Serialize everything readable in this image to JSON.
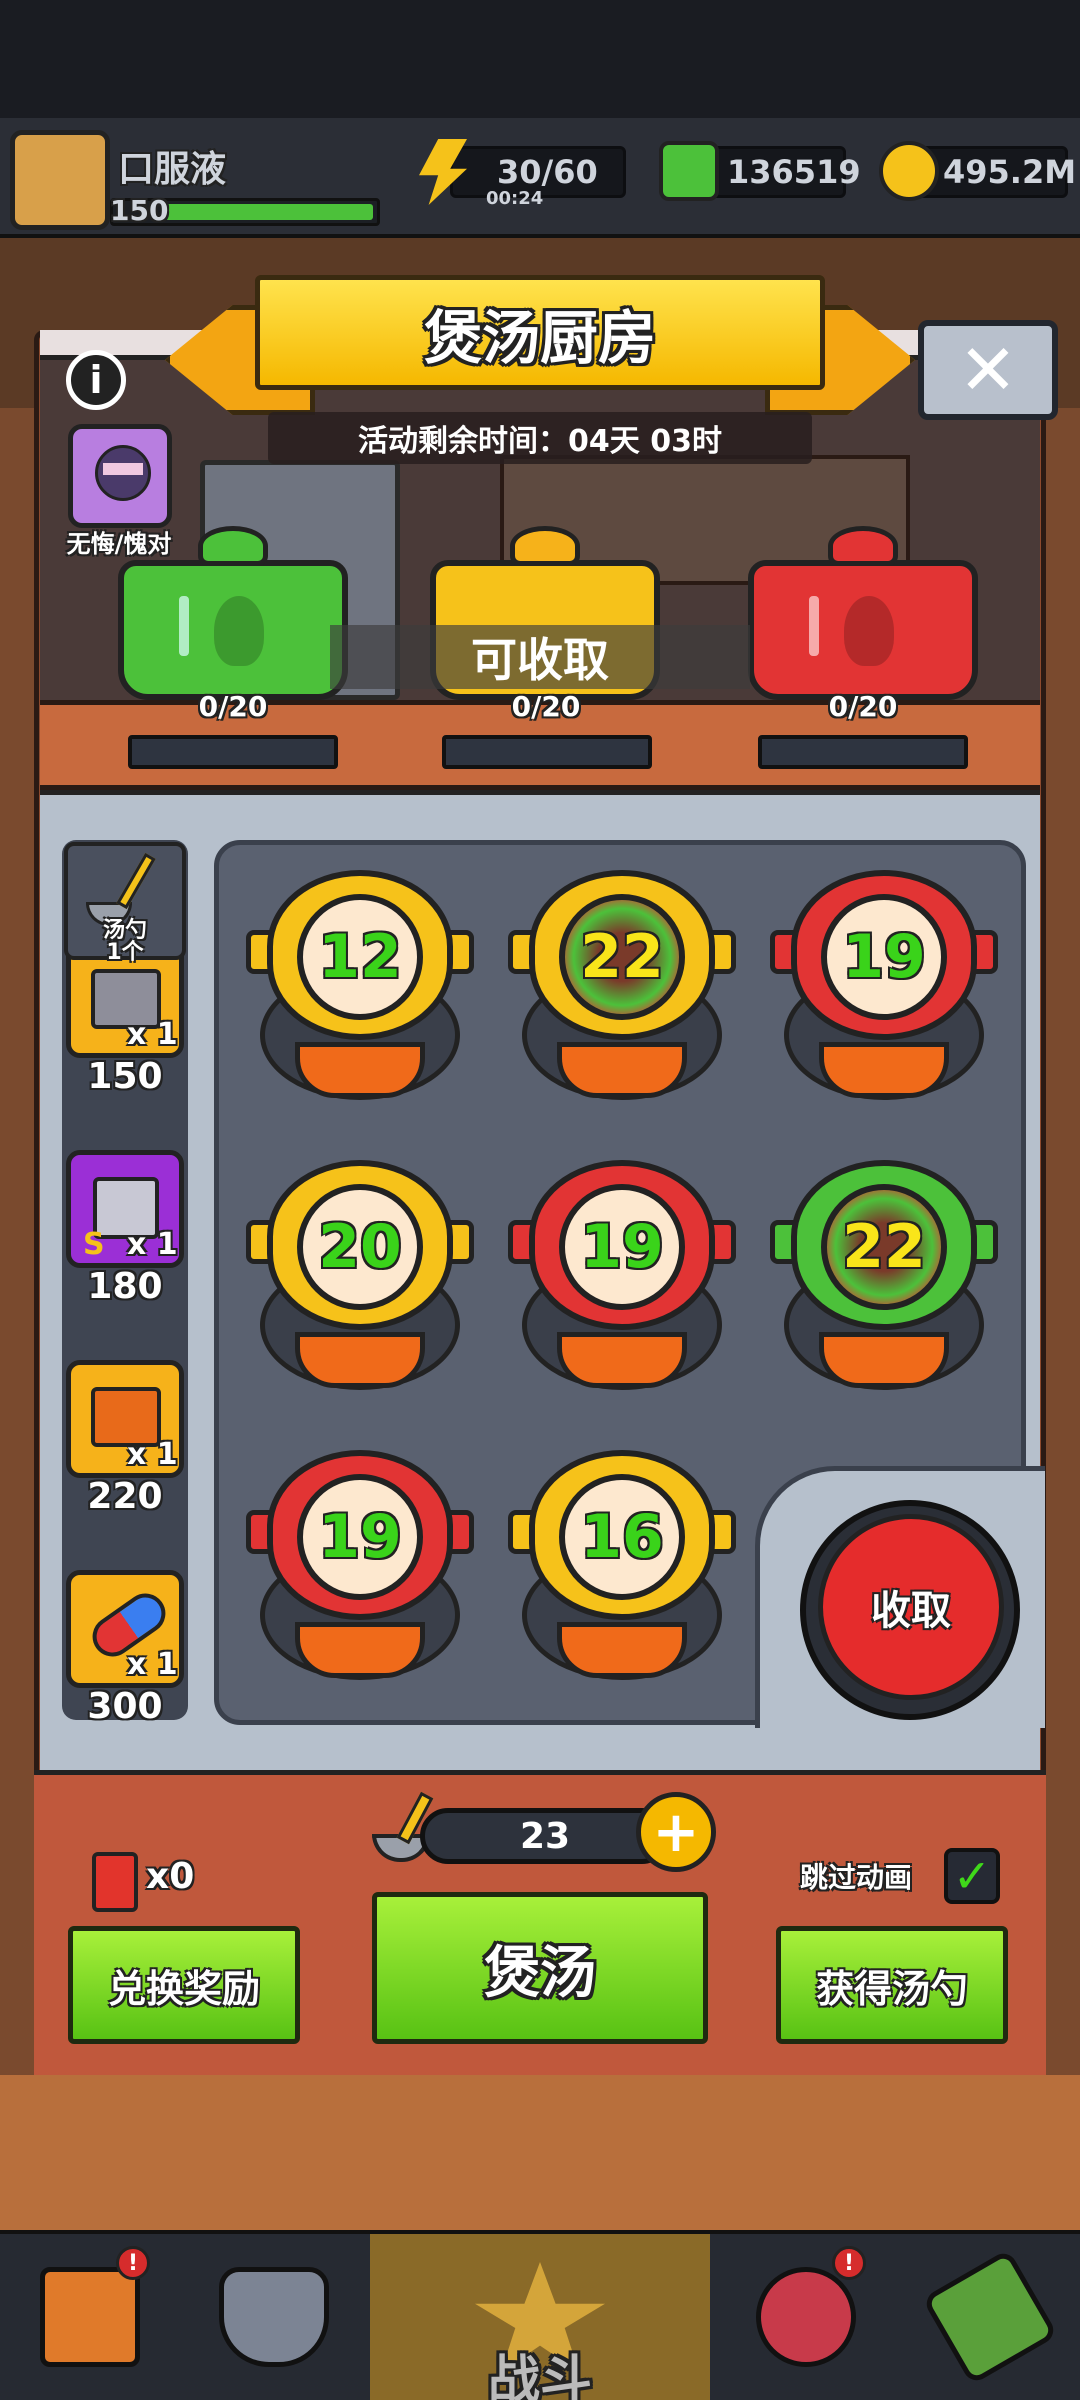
{
  "header": {
    "player_name": "口服液",
    "player_level": "150",
    "energy": "30/60",
    "energy_timer": "00:24",
    "gems": "136519",
    "coins": "495.2M"
  },
  "dialog": {
    "title": "煲汤厨房",
    "time_remaining": "活动剩余时间：04天 03时",
    "avatar_caption": "无悔/愧对",
    "collectable_label": "可收取",
    "big_pots": [
      {
        "color": "#4cc13a",
        "progress": "0/20"
      },
      {
        "color": "#f6c21a",
        "progress": "0/20"
      },
      {
        "color": "#e23434",
        "progress": "0/20"
      }
    ]
  },
  "sidebar": {
    "ladle_slot_label": "汤勺\n1个",
    "rewards": [
      {
        "icon": "orange-chest-icon",
        "qty": "x 1",
        "cost": "150"
      },
      {
        "icon": "purple-chest-icon",
        "qty": "x 1",
        "cost": "180",
        "tag": "S"
      },
      {
        "icon": "skull-chest-icon",
        "qty": "x 1",
        "cost": "220"
      },
      {
        "icon": "pill-icon",
        "qty": "x 1",
        "cost": "300"
      }
    ]
  },
  "pots": [
    {
      "color": "yellow",
      "value": "12"
    },
    {
      "color": "yellow",
      "value": "22",
      "filled": true
    },
    {
      "color": "red",
      "value": "19"
    },
    {
      "color": "yellow",
      "value": "20"
    },
    {
      "color": "red",
      "value": "19"
    },
    {
      "color": "green",
      "value": "22",
      "filled": true
    },
    {
      "color": "red",
      "value": "19"
    },
    {
      "color": "yellow",
      "value": "16"
    }
  ],
  "collect_button": "收取",
  "controls": {
    "ticket_count": "x0",
    "ladle_count": "23",
    "skip_animation_label": "跳过动画",
    "skip_animation_checked": true,
    "redeem_button": "兑换奖励",
    "cook_button": "煲汤",
    "get_ladle_button": "获得汤勺"
  },
  "nav": {
    "battle_label": "战斗",
    "badge": "!"
  }
}
